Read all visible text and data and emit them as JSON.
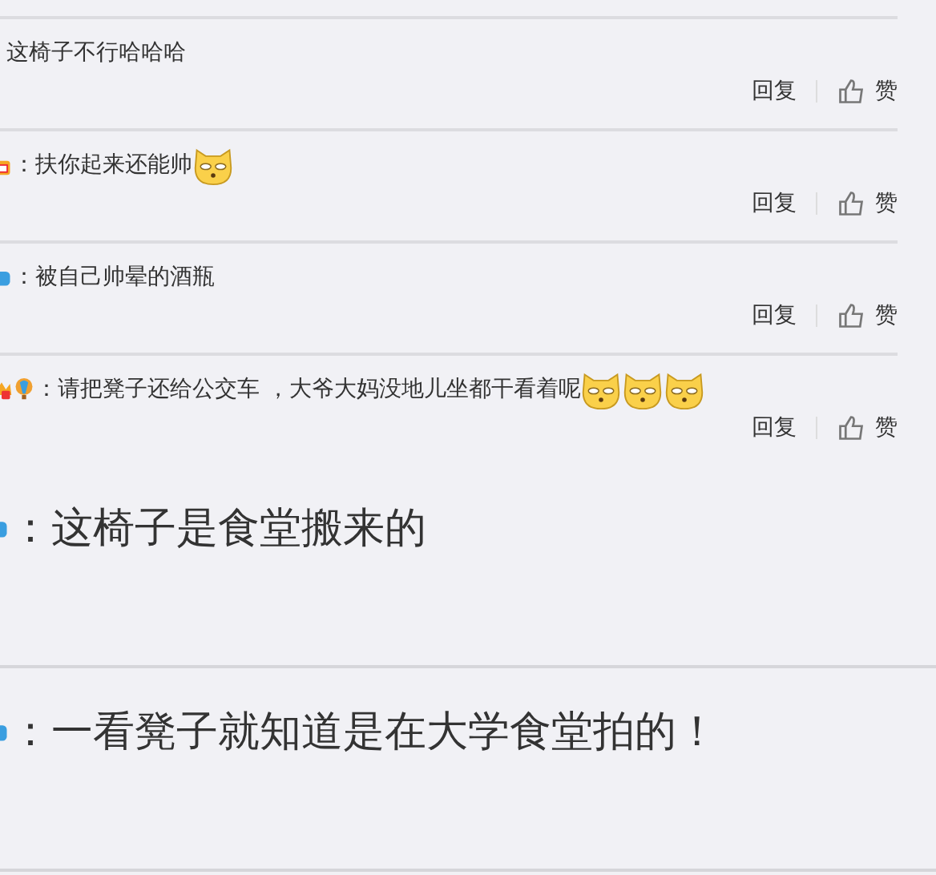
{
  "comments": [
    {
      "text": "这椅子不行哈哈哈",
      "reply": "回复",
      "like": "赞"
    },
    {
      "badges": [
        {
          "kind": "gift"
        }
      ],
      "text": "：扶你起来还能帅",
      "emojis": [
        {
          "kind": "dog"
        }
      ],
      "reply": "回复",
      "like": "赞"
    },
    {
      "badges": [
        {
          "kind": "blue"
        }
      ],
      "text": "：被自己帅晕的酒瓶",
      "reply": "回复",
      "like": "赞"
    },
    {
      "badges": [
        {
          "kind": "crown"
        },
        {
          "kind": "balloon"
        }
      ],
      "text": "：请把凳子还给公交车 ，大爷大妈没地儿坐都干看着呢",
      "emojis": [
        {
          "kind": "dog"
        },
        {
          "kind": "dog"
        },
        {
          "kind": "dog"
        }
      ],
      "reply": "回复",
      "like": "赞"
    }
  ],
  "posts": [
    {
      "badges": [
        {
          "kind": "blue"
        }
      ],
      "text": "：这椅子是食堂搬来的"
    },
    {
      "badges": [
        {
          "kind": "blue"
        }
      ],
      "text": "：一看凳子就知道是在大学食堂拍的！"
    }
  ]
}
